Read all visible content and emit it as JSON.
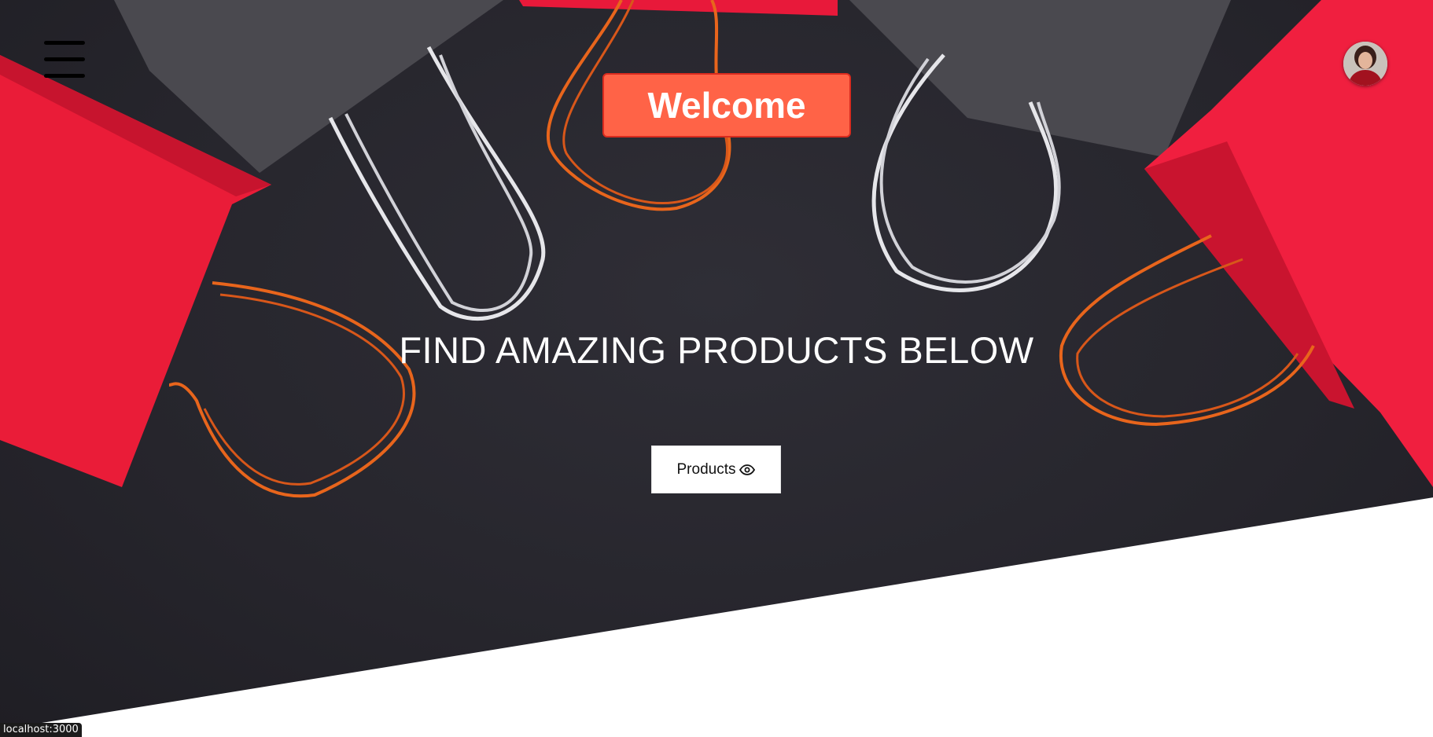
{
  "hero": {
    "welcome_label": "Welcome",
    "tagline": "FIND AMAZING PRODUCTS BELOW",
    "products_button_label": "Products",
    "products_button_icon": "eye-icon"
  },
  "header": {
    "menu_icon": "hamburger-menu-icon",
    "avatar_icon": "user-avatar"
  },
  "status_bar": {
    "url": "localhost:3000"
  },
  "colors": {
    "welcome_bg": "#ff6347",
    "welcome_border": "#d92b1e",
    "hero_bg": "#26252c",
    "bag_red": "#e81a33",
    "bag_gray": "#3f3e44",
    "handle_orange": "#e8651c",
    "handle_white": "#e6e6ea"
  }
}
